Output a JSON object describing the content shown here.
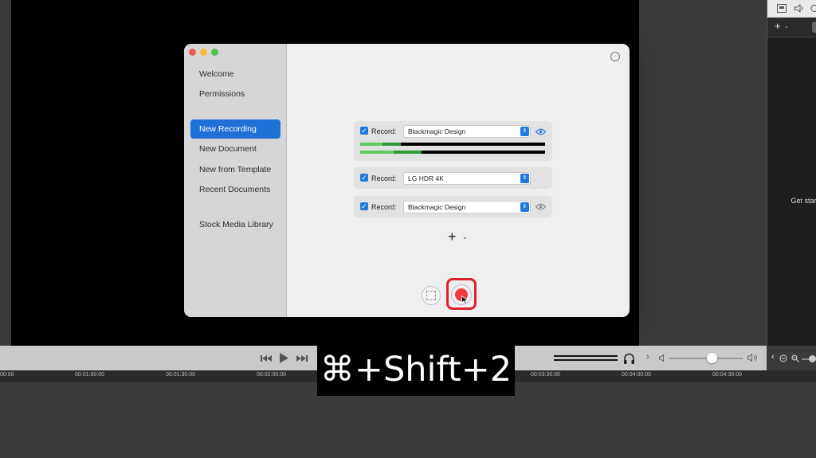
{
  "sidebar": {
    "items": [
      "Welcome",
      "Permissions",
      "New Recording",
      "New Document",
      "New from Template",
      "Recent Documents",
      "Stock Media Library"
    ],
    "selected": "New Recording"
  },
  "sources": [
    {
      "label": "Record:",
      "device": "Blackmagic Design",
      "meter_levels": [
        0.22,
        0.33
      ],
      "visible": true
    },
    {
      "label": "Record:",
      "device": "LG HDR 4K"
    },
    {
      "label": "Record:",
      "device": "Blackmagic Design",
      "visible": false
    }
  ],
  "add_source_symbol": "+",
  "right_panel": {
    "hint": "Get started\nhe"
  },
  "timeline": {
    "ticks": [
      "00:00",
      "00:01:00:00",
      "00:01:30:00",
      "00:02:00:00",
      "00:03:30:00",
      "00:04:00:00",
      "00:04:30:00"
    ],
    "volume_level": 0.58
  },
  "overlay": {
    "shortcut": "⌘+Shift+2"
  },
  "colors": {
    "accent": "#1f6fd6",
    "record": "#ef3b3b",
    "highlight": "#e0202c",
    "meter": "#5ccb5f"
  }
}
